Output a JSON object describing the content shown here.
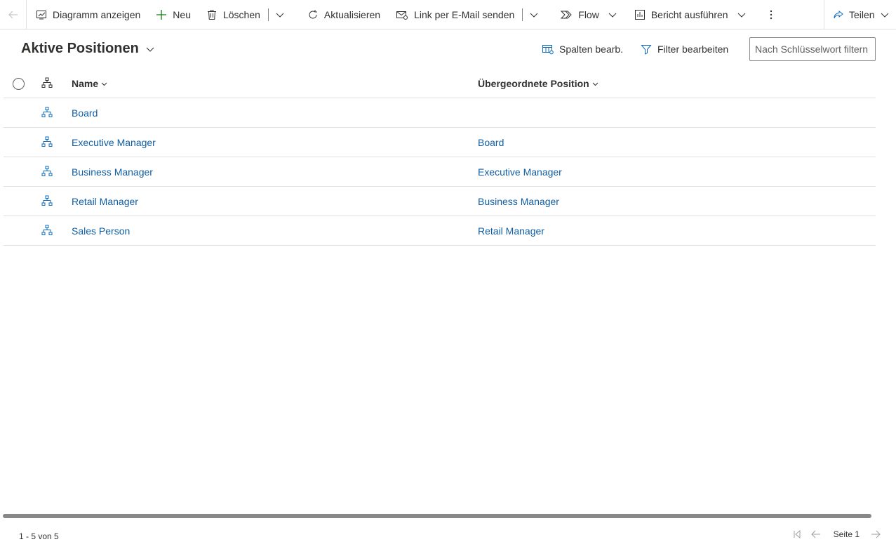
{
  "toolbar": {
    "show_chart": "Diagramm anzeigen",
    "new": "Neu",
    "delete": "Löschen",
    "refresh": "Aktualisieren",
    "email_link": "Link per E-Mail senden",
    "flow": "Flow",
    "run_report": "Bericht ausführen",
    "share": "Teilen"
  },
  "view": {
    "title": "Aktive Positionen",
    "edit_columns": "Spalten bearb.",
    "edit_filters": "Filter bearbeiten",
    "search_placeholder": "Nach Schlüsselwort filtern"
  },
  "grid": {
    "columns": {
      "name": "Name",
      "parent": "Übergeordnete Position"
    },
    "rows": [
      {
        "name": "Board",
        "parent": ""
      },
      {
        "name": "Executive Manager",
        "parent": "Board"
      },
      {
        "name": "Business Manager",
        "parent": "Executive Manager"
      },
      {
        "name": "Retail Manager",
        "parent": "Business Manager"
      },
      {
        "name": "Sales Person",
        "parent": "Retail Manager"
      }
    ]
  },
  "footer": {
    "count": "1 - 5 von 5",
    "page": "Seite 1"
  },
  "icons": {
    "back": "back-arrow-icon",
    "chart": "chart-icon",
    "add": "plus-icon",
    "delete": "trash-icon",
    "refresh": "refresh-icon",
    "email": "email-link-icon",
    "flow": "flow-icon",
    "report": "report-icon",
    "more": "more-vertical-icon",
    "share": "share-icon",
    "columns": "columns-icon",
    "filter": "filter-icon",
    "hierarchy": "hierarchy-icon"
  },
  "colors": {
    "link": "#115ea3",
    "hierarchy_icon": "#0f6cbd",
    "new_icon": "#107c10",
    "border": "#e1dfdd"
  }
}
